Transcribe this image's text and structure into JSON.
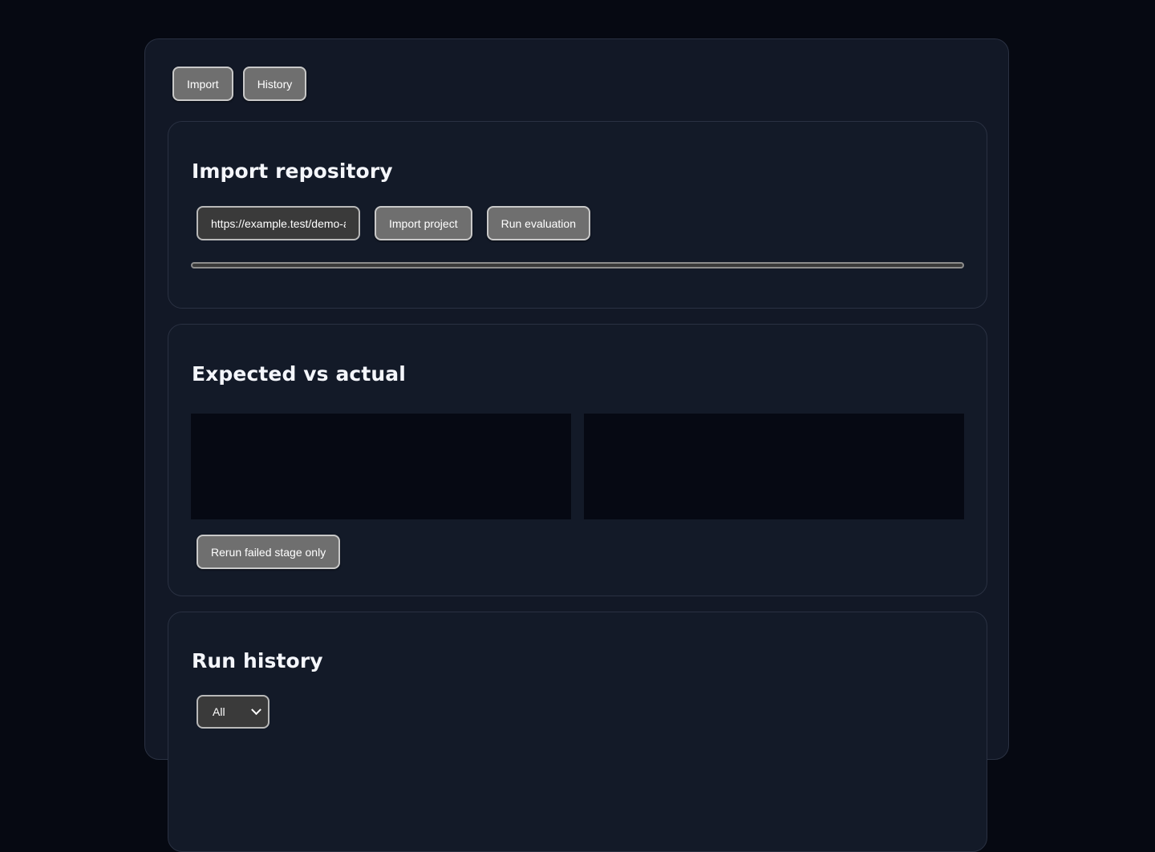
{
  "nav": {
    "import_label": "Import",
    "history_label": "History"
  },
  "import_panel": {
    "title": "Import repository",
    "repo_url_value": "https://example.test/demo-ag",
    "import_button_label": "Import project",
    "run_button_label": "Run evaluation",
    "progress_fraction": 0.0
  },
  "compare_panel": {
    "title": "Expected vs actual",
    "rerun_button_label": "Rerun failed stage only"
  },
  "history_panel": {
    "title": "Run history",
    "filter_selected": "All"
  },
  "colors": {
    "page_background": "#060912",
    "card_background": "#131a28",
    "button_background": "#6f6f6f",
    "input_background": "#3a3a3a"
  }
}
